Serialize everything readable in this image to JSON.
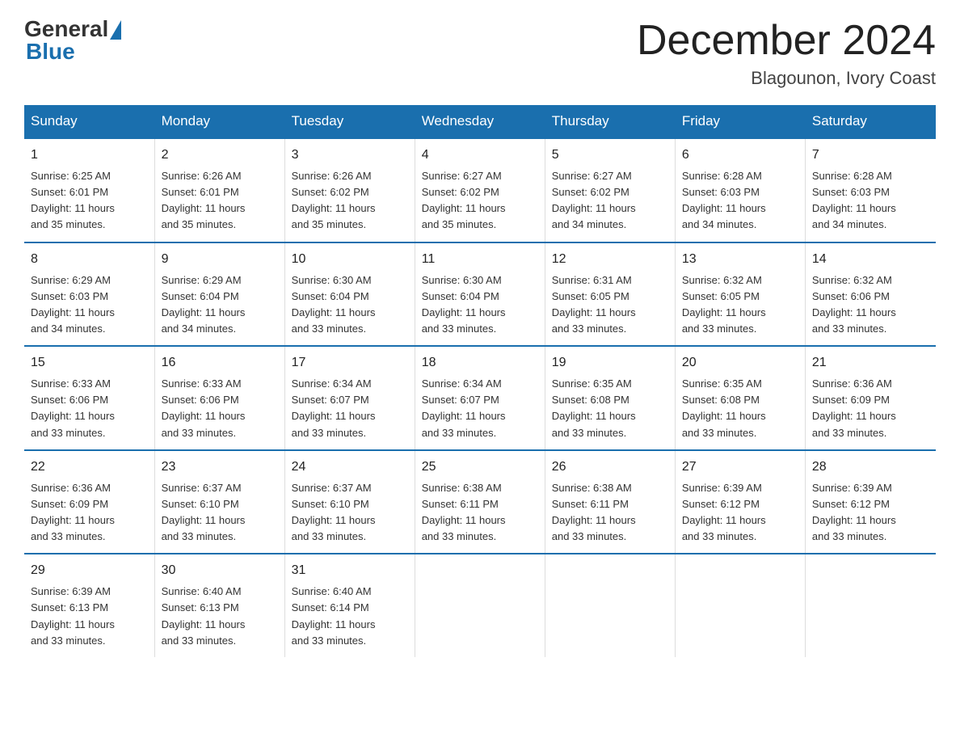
{
  "header": {
    "logo_general": "General",
    "logo_blue": "Blue",
    "month_title": "December 2024",
    "location": "Blagounon, Ivory Coast"
  },
  "days_of_week": [
    "Sunday",
    "Monday",
    "Tuesday",
    "Wednesday",
    "Thursday",
    "Friday",
    "Saturday"
  ],
  "weeks": [
    [
      {
        "day": "1",
        "sunrise": "6:25 AM",
        "sunset": "6:01 PM",
        "daylight": "11 hours and 35 minutes."
      },
      {
        "day": "2",
        "sunrise": "6:26 AM",
        "sunset": "6:01 PM",
        "daylight": "11 hours and 35 minutes."
      },
      {
        "day": "3",
        "sunrise": "6:26 AM",
        "sunset": "6:02 PM",
        "daylight": "11 hours and 35 minutes."
      },
      {
        "day": "4",
        "sunrise": "6:27 AM",
        "sunset": "6:02 PM",
        "daylight": "11 hours and 35 minutes."
      },
      {
        "day": "5",
        "sunrise": "6:27 AM",
        "sunset": "6:02 PM",
        "daylight": "11 hours and 34 minutes."
      },
      {
        "day": "6",
        "sunrise": "6:28 AM",
        "sunset": "6:03 PM",
        "daylight": "11 hours and 34 minutes."
      },
      {
        "day": "7",
        "sunrise": "6:28 AM",
        "sunset": "6:03 PM",
        "daylight": "11 hours and 34 minutes."
      }
    ],
    [
      {
        "day": "8",
        "sunrise": "6:29 AM",
        "sunset": "6:03 PM",
        "daylight": "11 hours and 34 minutes."
      },
      {
        "day": "9",
        "sunrise": "6:29 AM",
        "sunset": "6:04 PM",
        "daylight": "11 hours and 34 minutes."
      },
      {
        "day": "10",
        "sunrise": "6:30 AM",
        "sunset": "6:04 PM",
        "daylight": "11 hours and 33 minutes."
      },
      {
        "day": "11",
        "sunrise": "6:30 AM",
        "sunset": "6:04 PM",
        "daylight": "11 hours and 33 minutes."
      },
      {
        "day": "12",
        "sunrise": "6:31 AM",
        "sunset": "6:05 PM",
        "daylight": "11 hours and 33 minutes."
      },
      {
        "day": "13",
        "sunrise": "6:32 AM",
        "sunset": "6:05 PM",
        "daylight": "11 hours and 33 minutes."
      },
      {
        "day": "14",
        "sunrise": "6:32 AM",
        "sunset": "6:06 PM",
        "daylight": "11 hours and 33 minutes."
      }
    ],
    [
      {
        "day": "15",
        "sunrise": "6:33 AM",
        "sunset": "6:06 PM",
        "daylight": "11 hours and 33 minutes."
      },
      {
        "day": "16",
        "sunrise": "6:33 AM",
        "sunset": "6:06 PM",
        "daylight": "11 hours and 33 minutes."
      },
      {
        "day": "17",
        "sunrise": "6:34 AM",
        "sunset": "6:07 PM",
        "daylight": "11 hours and 33 minutes."
      },
      {
        "day": "18",
        "sunrise": "6:34 AM",
        "sunset": "6:07 PM",
        "daylight": "11 hours and 33 minutes."
      },
      {
        "day": "19",
        "sunrise": "6:35 AM",
        "sunset": "6:08 PM",
        "daylight": "11 hours and 33 minutes."
      },
      {
        "day": "20",
        "sunrise": "6:35 AM",
        "sunset": "6:08 PM",
        "daylight": "11 hours and 33 minutes."
      },
      {
        "day": "21",
        "sunrise": "6:36 AM",
        "sunset": "6:09 PM",
        "daylight": "11 hours and 33 minutes."
      }
    ],
    [
      {
        "day": "22",
        "sunrise": "6:36 AM",
        "sunset": "6:09 PM",
        "daylight": "11 hours and 33 minutes."
      },
      {
        "day": "23",
        "sunrise": "6:37 AM",
        "sunset": "6:10 PM",
        "daylight": "11 hours and 33 minutes."
      },
      {
        "day": "24",
        "sunrise": "6:37 AM",
        "sunset": "6:10 PM",
        "daylight": "11 hours and 33 minutes."
      },
      {
        "day": "25",
        "sunrise": "6:38 AM",
        "sunset": "6:11 PM",
        "daylight": "11 hours and 33 minutes."
      },
      {
        "day": "26",
        "sunrise": "6:38 AM",
        "sunset": "6:11 PM",
        "daylight": "11 hours and 33 minutes."
      },
      {
        "day": "27",
        "sunrise": "6:39 AM",
        "sunset": "6:12 PM",
        "daylight": "11 hours and 33 minutes."
      },
      {
        "day": "28",
        "sunrise": "6:39 AM",
        "sunset": "6:12 PM",
        "daylight": "11 hours and 33 minutes."
      }
    ],
    [
      {
        "day": "29",
        "sunrise": "6:39 AM",
        "sunset": "6:13 PM",
        "daylight": "11 hours and 33 minutes."
      },
      {
        "day": "30",
        "sunrise": "6:40 AM",
        "sunset": "6:13 PM",
        "daylight": "11 hours and 33 minutes."
      },
      {
        "day": "31",
        "sunrise": "6:40 AM",
        "sunset": "6:14 PM",
        "daylight": "11 hours and 33 minutes."
      },
      {
        "day": "",
        "sunrise": "",
        "sunset": "",
        "daylight": ""
      },
      {
        "day": "",
        "sunrise": "",
        "sunset": "",
        "daylight": ""
      },
      {
        "day": "",
        "sunrise": "",
        "sunset": "",
        "daylight": ""
      },
      {
        "day": "",
        "sunrise": "",
        "sunset": "",
        "daylight": ""
      }
    ]
  ],
  "labels": {
    "sunrise": "Sunrise:",
    "sunset": "Sunset:",
    "daylight": "Daylight:"
  }
}
